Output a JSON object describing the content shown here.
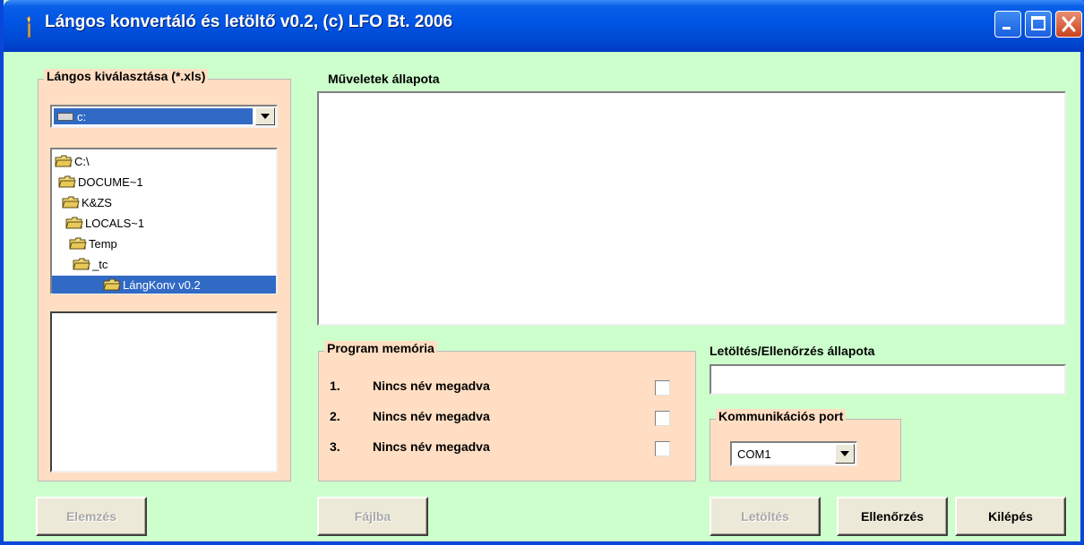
{
  "window": {
    "title": "Lángos konvertáló és letöltő v0.2, (c) LFO Bt. 2006"
  },
  "file_select": {
    "legend": "Lángos kiválasztása (*.xls)",
    "drive_value": "c:",
    "tree": [
      {
        "label": "C:\\",
        "selected": false
      },
      {
        "label": "DOCUME~1",
        "selected": false
      },
      {
        "label": "K&ZS",
        "selected": false
      },
      {
        "label": "LOCALS~1",
        "selected": false
      },
      {
        "label": "Temp",
        "selected": false
      },
      {
        "label": "_tc",
        "selected": false
      },
      {
        "label": "LángKonv v0.2",
        "selected": true
      }
    ]
  },
  "status": {
    "label": "Műveletek állapota"
  },
  "memory": {
    "legend": "Program memória",
    "items": [
      {
        "num": "1.",
        "name": "Nincs név megadva",
        "checked": false
      },
      {
        "num": "2.",
        "name": "Nincs név megadva",
        "checked": false
      },
      {
        "num": "3.",
        "name": "Nincs név megadva",
        "checked": false
      }
    ]
  },
  "download": {
    "label": "Letöltés/Ellenőrzés állapota"
  },
  "port": {
    "legend": "Kommunikációs port",
    "value": "COM1"
  },
  "buttons": {
    "analyze": "Elemzés",
    "to_file": "Fájlba",
    "download": "Letöltés",
    "verify": "Ellenőrzés",
    "exit": "Kilépés"
  },
  "colors": {
    "window_bg": "#ccffcc",
    "group_bg": "#ffdec3",
    "selection": "#316ac5",
    "titlebar": "#0054e3"
  },
  "icons": {
    "app": "torch-icon",
    "minimize": "minimize-icon",
    "maximize": "maximize-icon",
    "close": "close-icon",
    "drive": "drive-icon",
    "folder": "folder-icon"
  }
}
